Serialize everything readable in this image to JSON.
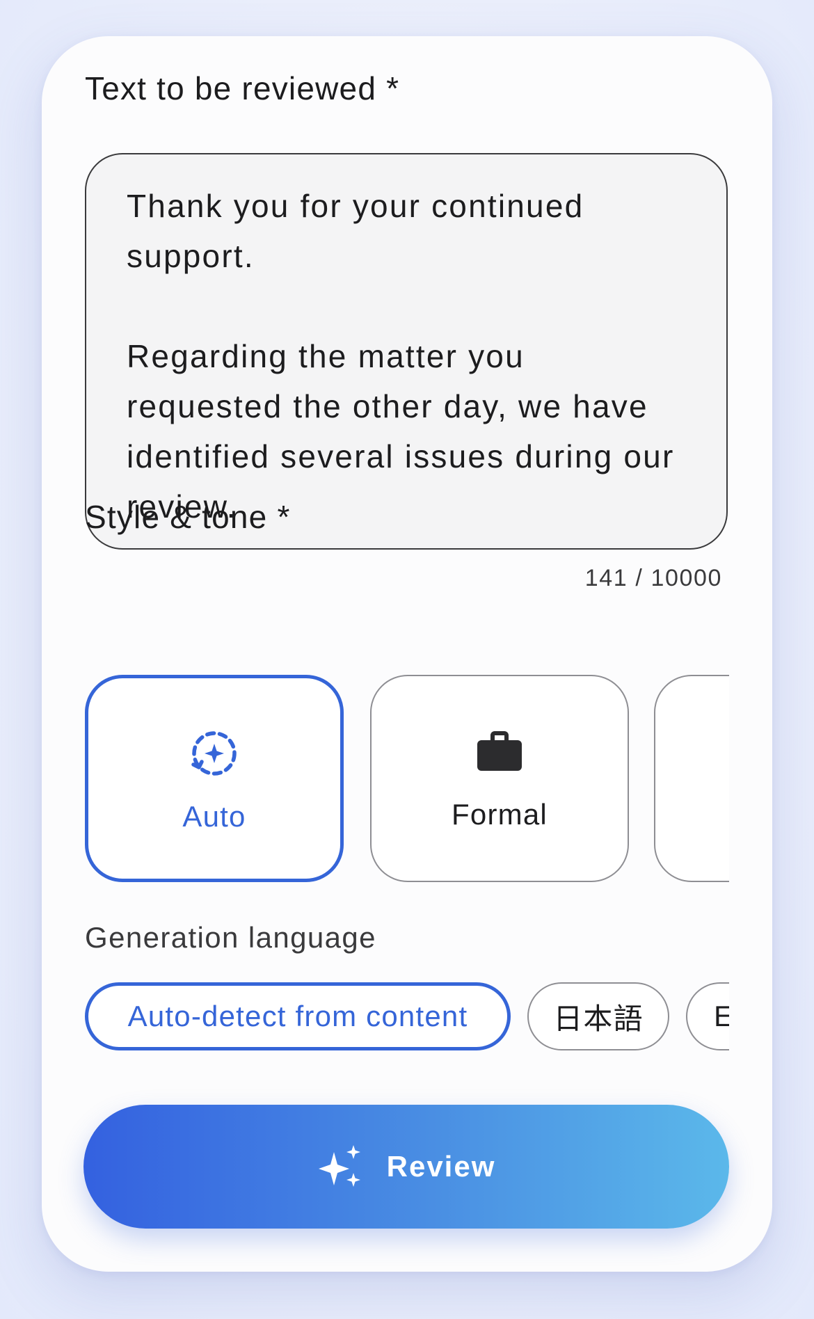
{
  "text_section": {
    "title": "Text to be reviewed",
    "required_mark": "*",
    "value": "Thank you for your continued support.\n\nRegarding the matter you requested the other day, we have identified several issues during our review.",
    "counter": "141 / 10000"
  },
  "tone_section": {
    "title": "Style & tone",
    "required_mark": "*",
    "options": [
      {
        "label": "Auto",
        "icon": "auto-sparkle-icon",
        "selected": true
      },
      {
        "label": "Formal",
        "icon": "briefcase-icon",
        "selected": false
      },
      {
        "label": "",
        "icon": "",
        "selected": false
      }
    ]
  },
  "language_section": {
    "title": "Generation language",
    "options": [
      {
        "label": "Auto-detect from content",
        "selected": true
      },
      {
        "label": "日本語",
        "selected": false
      },
      {
        "label": "E",
        "selected": false
      }
    ]
  },
  "review_button": {
    "label": "Review",
    "icon": "sparkles-icon"
  },
  "colors": {
    "accent": "#3565d8",
    "button_gradient_start": "#3461e0",
    "button_gradient_end": "#5bb8ea",
    "text": "#1c1c1e",
    "border": "#8e8e93"
  }
}
